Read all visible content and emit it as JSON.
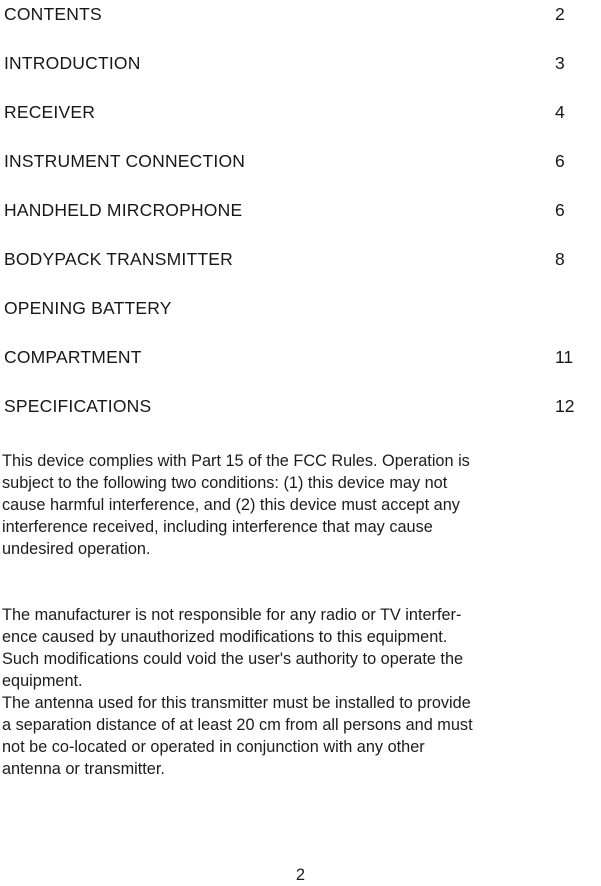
{
  "document": {
    "page_number": "2",
    "contents": {
      "entries": [
        {
          "title": "CONTENTS",
          "page": "2"
        },
        {
          "title": "INTRODUCTION",
          "page": "3"
        },
        {
          "title": "RECEIVER",
          "page": "4"
        },
        {
          "title": "INSTRUMENT CONNECTION",
          "page": "6"
        },
        {
          "title": "HANDHELD MIRCROPHONE",
          "page": "6"
        },
        {
          "title": "BODYPACK TRANSMITTER",
          "page": "8"
        },
        {
          "title": "OPENING BATTERY",
          "page": ""
        },
        {
          "title": "COMPARTMENT",
          "page": "11"
        },
        {
          "title": "SPECIFICATIONS",
          "page": "12"
        }
      ]
    },
    "paragraphs": [
      {
        "id": "fcc-compliance-statement",
        "lines": [
          "This device complies with Part 15 of the FCC Rules. Operation is",
          "subject to the following two conditions: (1) this device may not",
          "cause harmful interference, and (2) this device must accept any",
          "interference received, including interference that may cause",
          "undesired operation."
        ]
      },
      {
        "id": "manufacturer-liability-and-rf-exposure-statement",
        "lines": [
          "The manufacturer is not responsible for any radio or TV interfer-",
          "ence caused by unauthorized modifications to this equipment.",
          "Such modifications could void the user's authority to operate the",
          "equipment.",
          "The antenna used for this transmitter must be installed to provide",
          "a separation distance of at least 20 cm from all persons and must",
          "not be co-located or operated in conjunction with any other",
          "antenna or transmitter."
        ]
      }
    ]
  },
  "colors": {
    "page_background": "#ffffff",
    "text": "#1a1a1a"
  }
}
